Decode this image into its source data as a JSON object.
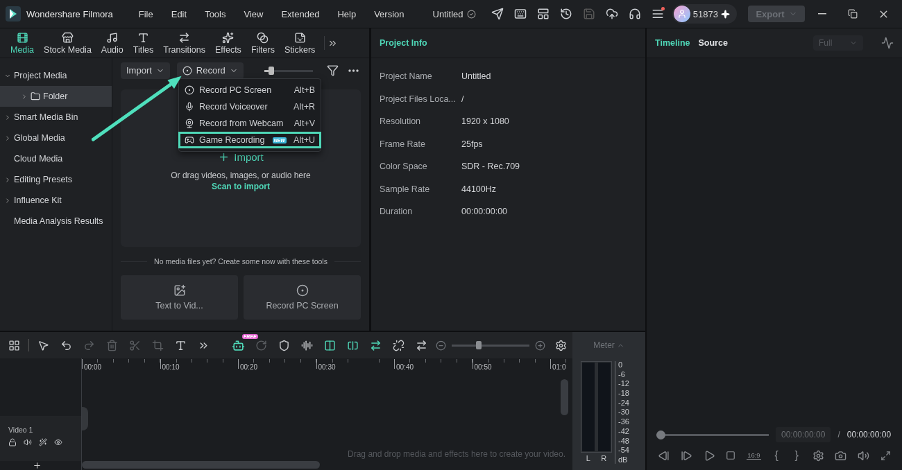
{
  "app": {
    "name": "Wondershare Filmora"
  },
  "menu": [
    "File",
    "Edit",
    "Tools",
    "View",
    "Extended",
    "Help",
    "Version"
  ],
  "project_title": "Untitled",
  "account": {
    "id": "51873"
  },
  "export_button": {
    "label": "Export",
    "disabled": true
  },
  "media_tabs": [
    {
      "label": "Media",
      "selected": true
    },
    {
      "label": "Stock Media",
      "selected": false
    },
    {
      "label": "Audio",
      "selected": false
    },
    {
      "label": "Titles",
      "selected": false
    },
    {
      "label": "Transitions",
      "selected": false
    },
    {
      "label": "Effects",
      "selected": false
    },
    {
      "label": "Filters",
      "selected": false
    },
    {
      "label": "Stickers",
      "selected": false
    }
  ],
  "sidebar": {
    "items": [
      {
        "label": "Project Media",
        "expanded": true,
        "selected": false,
        "children": [
          {
            "label": "Folder",
            "expanded": false,
            "selected": true
          }
        ]
      },
      {
        "label": "Smart Media Bin",
        "expanded": false,
        "selected": false
      },
      {
        "label": "Global Media",
        "expanded": false,
        "selected": false
      },
      {
        "label": "Cloud Media",
        "selected": false
      },
      {
        "label": "Editing Presets",
        "expanded": false,
        "selected": false
      },
      {
        "label": "Influence Kit",
        "expanded": false,
        "selected": false
      },
      {
        "label": "Media Analysis Results",
        "selected": false
      }
    ]
  },
  "media_toolbar": {
    "import": "Import",
    "record": "Record",
    "thumbnail_size": {
      "level": 0.15
    }
  },
  "record_menu": {
    "items": [
      {
        "kind": "screen",
        "label": "Record PC Screen",
        "shortcut": "Alt+B",
        "highlighted": false
      },
      {
        "kind": "voice",
        "label": "Record Voiceover",
        "shortcut": "Alt+R",
        "highlighted": false
      },
      {
        "kind": "webcam",
        "label": "Record from Webcam",
        "shortcut": "Alt+V",
        "highlighted": false
      },
      {
        "kind": "game",
        "label": "Game Recording",
        "badge": "NEW",
        "shortcut": "Alt+U",
        "highlighted": true
      }
    ]
  },
  "drop_zone": {
    "title": "Import",
    "hint": "Or drag videos, images, or audio here",
    "link": "Scan to import"
  },
  "create_tools": {
    "caption": "No media files yet? Create some now with these tools",
    "tools": [
      {
        "kind": "text",
        "label": "Text to Vid..."
      },
      {
        "kind": "record",
        "label": "Record PC Screen"
      }
    ]
  },
  "project_info": {
    "title": "Project Info",
    "rows": [
      {
        "label": "Project Name",
        "value": "Untitled"
      },
      {
        "label": "Project Files Loca...",
        "value": "/"
      },
      {
        "label": "Resolution",
        "value": "1920 x 1080"
      },
      {
        "label": "Frame Rate",
        "value": "25fps"
      },
      {
        "label": "Color Space",
        "value": "SDR - Rec.709"
      },
      {
        "label": "Sample Rate",
        "value": "44100Hz"
      },
      {
        "label": "Duration",
        "value": "00:00:00:00"
      }
    ]
  },
  "timeline": {
    "ai_badge": "FREE",
    "zoom": {
      "level": 0.35
    },
    "ruler": [
      "00:00",
      "00:10",
      "00:20",
      "00:30",
      "00:40",
      "00:50",
      "01:0"
    ],
    "tracks": [
      {
        "name": "Video 1"
      }
    ],
    "drop_hint": "Drag and drop media and effects here to create your video.",
    "meter": {
      "title": "Meter",
      "scale": [
        "0",
        "-6",
        "-12",
        "-18",
        "-24",
        "-30",
        "-36",
        "-42",
        "-48",
        "-54",
        "dB"
      ],
      "channels": [
        "L",
        "R"
      ]
    }
  },
  "viewer": {
    "tabs": [
      {
        "label": "Timeline",
        "selected": true
      },
      {
        "label": "Source",
        "selected": false
      }
    ],
    "quality": {
      "value": "Full",
      "disabled": true
    },
    "playhead": {
      "level": 0
    },
    "current_time": "00:00:00:00",
    "separator": "/",
    "duration": "00:00:00:00",
    "aspect_ratio": "16:9",
    "mark_in": "{",
    "mark_out": "}"
  }
}
